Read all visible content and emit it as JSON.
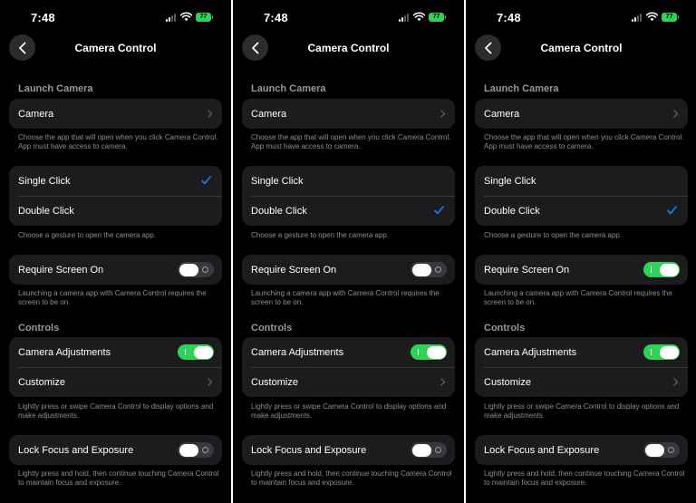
{
  "colors": {
    "accent": "#0a84ff",
    "toggle_on": "#30d158",
    "background": "#000000",
    "cell": "#1c1c1e"
  },
  "screens": [
    {
      "status": {
        "time": "7:48",
        "battery": "77"
      },
      "nav": {
        "title": "Camera Control",
        "back_icon": "chevron-left-icon"
      },
      "launch": {
        "header": "Launch Camera",
        "camera_label": "Camera",
        "footnote": "Choose the app that will open when you click Camera Control. App must have access to camera."
      },
      "gesture": {
        "single_label": "Single Click",
        "double_label": "Double Click",
        "selected": "single",
        "footnote": "Choose a gesture to open the camera app."
      },
      "screen_on": {
        "label": "Require Screen On",
        "enabled": false,
        "footnote": "Launching a camera app with Camera Control requires the screen to be on."
      },
      "controls": {
        "header": "Controls",
        "adjustments_label": "Camera Adjustments",
        "adjustments_enabled": true,
        "customize_label": "Customize",
        "footnote": "Lightly press or swipe Camera Control to display options and make adjustments."
      },
      "lock": {
        "label": "Lock Focus and Exposure",
        "enabled": false,
        "footnote": "Lightly press and hold, then continue touching Camera Control to maintain focus and exposure."
      }
    },
    {
      "status": {
        "time": "7:48",
        "battery": "77"
      },
      "nav": {
        "title": "Camera Control",
        "back_icon": "chevron-left-icon"
      },
      "launch": {
        "header": "Launch Camera",
        "camera_label": "Camera",
        "footnote": "Choose the app that will open when you click Camera Control. App must have access to camera."
      },
      "gesture": {
        "single_label": "Single Click",
        "double_label": "Double Click",
        "selected": "double",
        "footnote": "Choose a gesture to open the camera app."
      },
      "screen_on": {
        "label": "Require Screen On",
        "enabled": false,
        "footnote": "Launching a camera app with Camera Control requires the screen to be on."
      },
      "controls": {
        "header": "Controls",
        "adjustments_label": "Camera Adjustments",
        "adjustments_enabled": true,
        "customize_label": "Customize",
        "footnote": "Lightly press or swipe Camera Control to display options and make adjustments."
      },
      "lock": {
        "label": "Lock Focus and Exposure",
        "enabled": false,
        "footnote": "Lightly press and hold, then continue touching Camera Control to maintain focus and exposure."
      }
    },
    {
      "status": {
        "time": "7:48",
        "battery": "77"
      },
      "nav": {
        "title": "Camera Control",
        "back_icon": "chevron-left-icon"
      },
      "launch": {
        "header": "Launch Camera",
        "camera_label": "Camera",
        "footnote": "Choose the app that will open when you click Camera Control. App must have access to camera."
      },
      "gesture": {
        "single_label": "Single Click",
        "double_label": "Double Click",
        "selected": "double",
        "footnote": "Choose a gesture to open the camera app."
      },
      "screen_on": {
        "label": "Require Screen On",
        "enabled": true,
        "footnote": "Launching a camera app with Camera Control requires the screen to be on."
      },
      "controls": {
        "header": "Controls",
        "adjustments_label": "Camera Adjustments",
        "adjustments_enabled": true,
        "customize_label": "Customize",
        "footnote": "Lightly press or swipe Camera Control to display options and make adjustments."
      },
      "lock": {
        "label": "Lock Focus and Exposure",
        "enabled": false,
        "footnote": "Lightly press and hold, then continue touching Camera Control to maintain focus and exposure."
      }
    }
  ]
}
